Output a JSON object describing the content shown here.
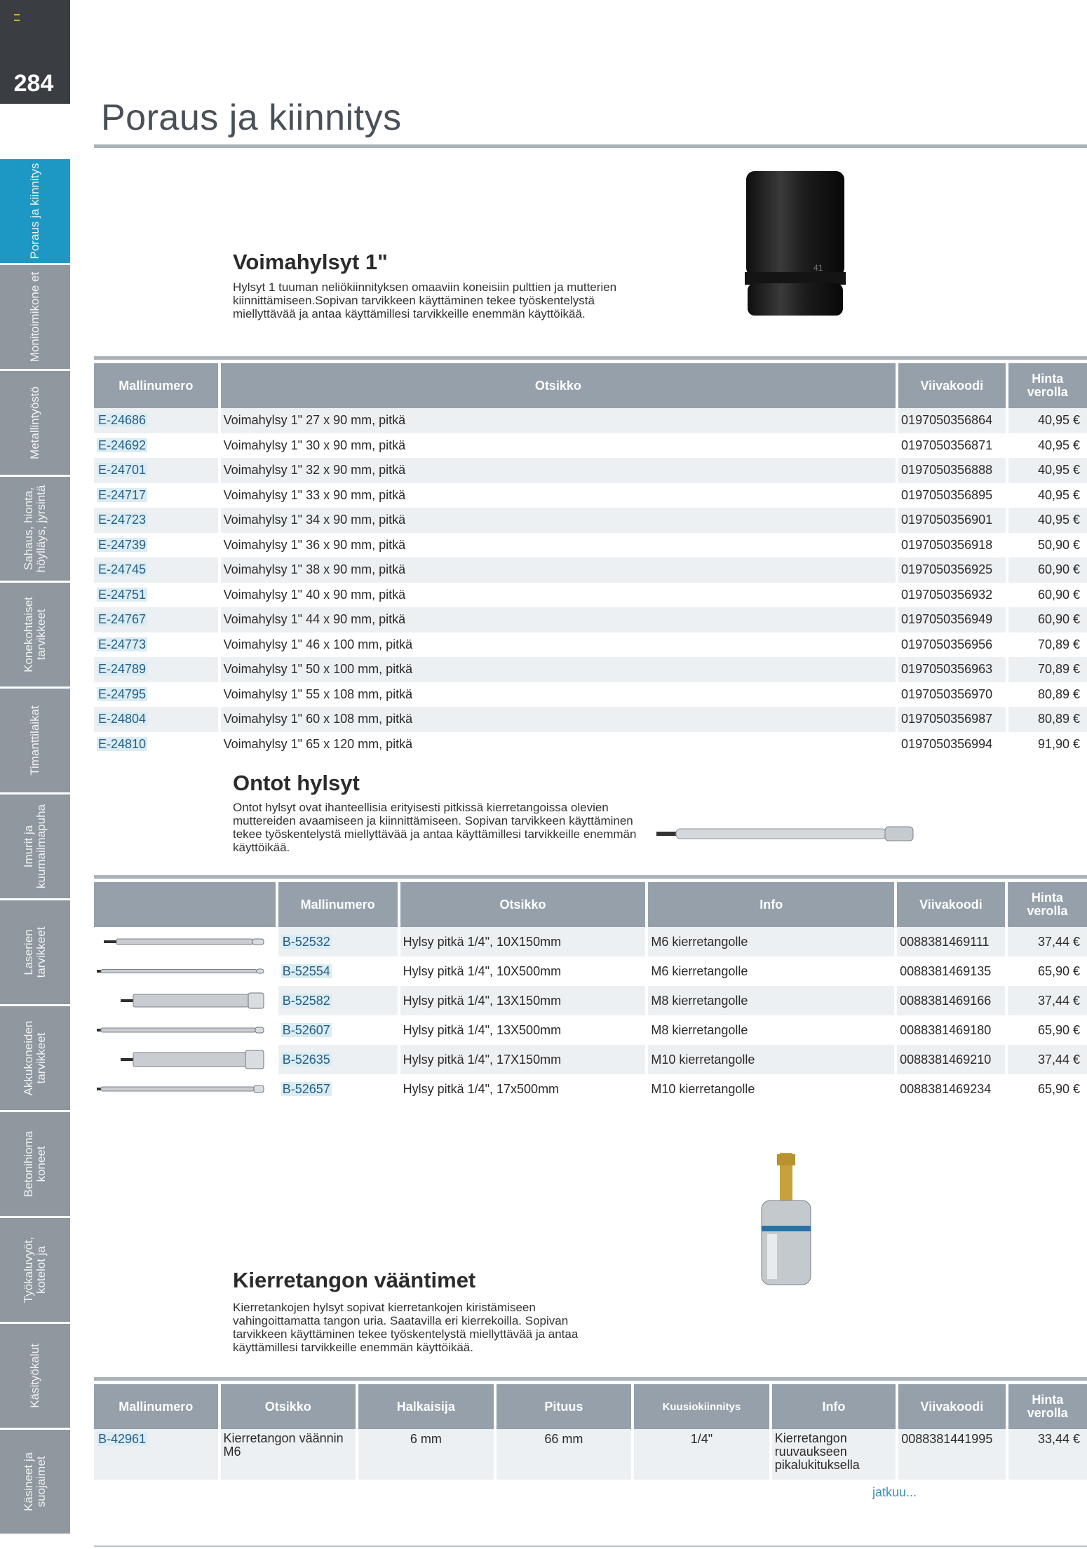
{
  "page": {
    "number": "284",
    "title": "Poraus ja kiinnitys",
    "continued": "jatkuu..."
  },
  "side_tabs": [
    {
      "label": "Poraus ja kiinnitys",
      "active": true
    },
    {
      "label": "Monitoimikone et",
      "active": false
    },
    {
      "label": "Metallintyöstö",
      "active": false
    },
    {
      "label": "Sahaus, hionta, höylläys, jyrsintä",
      "active": false
    },
    {
      "label": "Konekohtaiset tarvikkeet",
      "active": false
    },
    {
      "label": "Timanttilaikat",
      "active": false
    },
    {
      "label": "Imurit ja kuumailmapuha",
      "active": false
    },
    {
      "label": "Laserien tarvikkeet",
      "active": false
    },
    {
      "label": "Akkukoneiden tarvikkeet",
      "active": false
    },
    {
      "label": "Betonihioma koneet",
      "active": false
    },
    {
      "label": "Työkaluvyöt, kotelot ja",
      "active": false
    },
    {
      "label": "Käsityökalut",
      "active": false
    },
    {
      "label": "Käsineet ja suojaimet",
      "active": false
    }
  ],
  "voimahylsyt": {
    "title": "Voimahylsyt 1\"",
    "desc": "Hylsyt 1 tuuman neliökiinnityksen omaaviin koneisiin pulttien ja mutterien kiinnittämiseen.Sopivan tarvikkeen käyttäminen tekee työskentelystä miellyttävää ja antaa käyttämillesi tarvikkeille enemmän käyttöikää.",
    "headers": {
      "model": "Mallinumero",
      "title": "Otsikko",
      "barcode": "Viivakoodi",
      "price": "Hinta verolla"
    },
    "rows": [
      {
        "code": "E-24686",
        "title": "Voimahylsy 1\" 27 x 90 mm, pitkä",
        "barcode": "0197050356864",
        "price": "40,95 €"
      },
      {
        "code": "E-24692",
        "title": "Voimahylsy 1\" 30 x 90 mm, pitkä",
        "barcode": "0197050356871",
        "price": "40,95 €"
      },
      {
        "code": "E-24701",
        "title": "Voimahylsy 1\" 32 x 90 mm, pitkä",
        "barcode": "0197050356888",
        "price": "40,95 €"
      },
      {
        "code": "E-24717",
        "title": "Voimahylsy 1\" 33 x 90 mm, pitkä",
        "barcode": "0197050356895",
        "price": "40,95 €"
      },
      {
        "code": "E-24723",
        "title": "Voimahylsy 1\" 34 x 90 mm, pitkä",
        "barcode": "0197050356901",
        "price": "40,95 €"
      },
      {
        "code": "E-24739",
        "title": "Voimahylsy 1\" 36 x 90 mm, pitkä",
        "barcode": "0197050356918",
        "price": "50,90 €"
      },
      {
        "code": "E-24745",
        "title": "Voimahylsy 1\" 38 x 90 mm, pitkä",
        "barcode": "0197050356925",
        "price": "60,90 €"
      },
      {
        "code": "E-24751",
        "title": "Voimahylsy 1\" 40 x 90 mm, pitkä",
        "barcode": "0197050356932",
        "price": "60,90 €"
      },
      {
        "code": "E-24767",
        "title": "Voimahylsy 1\" 44 x 90 mm, pitkä",
        "barcode": "0197050356949",
        "price": "60,90 €"
      },
      {
        "code": "E-24773",
        "title": "Voimahylsy 1\" 46 x 100 mm, pitkä",
        "barcode": "0197050356956",
        "price": "70,89 €"
      },
      {
        "code": "E-24789",
        "title": "Voimahylsy 1\" 50 x 100 mm, pitkä",
        "barcode": "0197050356963",
        "price": "70,89 €"
      },
      {
        "code": "E-24795",
        "title": "Voimahylsy 1\" 55 x 108 mm, pitkä",
        "barcode": "0197050356970",
        "price": "80,89 €"
      },
      {
        "code": "E-24804",
        "title": "Voimahylsy 1\" 60 x 108 mm, pitkä",
        "barcode": "0197050356987",
        "price": "80,89 €"
      },
      {
        "code": "E-24810",
        "title": "Voimahylsy 1\" 65 x 120 mm, pitkä",
        "barcode": "0197050356994",
        "price": "91,90 €"
      }
    ]
  },
  "ontot": {
    "title": "Ontot hylsyt",
    "desc": "Ontot hylsyt ovat ihanteellisia erityisesti pitkissä kierretangoissa olevien muttereiden avaamiseen ja kiinnittämiseen. Sopivan tarvikkeen käyttäminen tekee työskentelystä miellyttävää ja antaa käyttämillesi tarvikkeille enemmän käyttöikää.",
    "headers": {
      "model": "Mallinumero",
      "title": "Otsikko",
      "info": "Info",
      "barcode": "Viivakoodi",
      "price": "Hinta verolla"
    },
    "rows": [
      {
        "code": "B-52532",
        "title": "Hylsy pitkä 1/4\", 10X150mm",
        "info": "M6 kierretangolle",
        "barcode": "0088381469111",
        "price": "37,44 €"
      },
      {
        "code": "B-52554",
        "title": "Hylsy pitkä 1/4\", 10X500mm",
        "info": "M6 kierretangolle",
        "barcode": "0088381469135",
        "price": "65,90 €"
      },
      {
        "code": "B-52582",
        "title": "Hylsy pitkä 1/4\", 13X150mm",
        "info": "M8 kierretangolle",
        "barcode": "0088381469166",
        "price": "37,44 €"
      },
      {
        "code": "B-52607",
        "title": "Hylsy pitkä 1/4\", 13X500mm",
        "info": "M8 kierretangolle",
        "barcode": "0088381469180",
        "price": "65,90 €"
      },
      {
        "code": "B-52635",
        "title": "Hylsy pitkä 1/4\", 17X150mm",
        "info": "M10 kierretangolle",
        "barcode": "0088381469210",
        "price": "37,44 €"
      },
      {
        "code": "B-52657",
        "title": "Hylsy pitkä 1/4\", 17x500mm",
        "info": "M10 kierretangolle",
        "barcode": "0088381469234",
        "price": "65,90 €"
      }
    ]
  },
  "kierretangon": {
    "title": "Kierretangon vääntimet",
    "desc": "Kierretankojen hylsyt sopivat kierretankojen kiristämiseen vahingoittamatta tangon uria. Saatavilla eri kierrekoilla. Sopivan tarvikkeen käyttäminen tekee työskentelystä miellyttävää ja antaa käyttämillesi tarvikkeille enemmän käyttöikää.",
    "headers": {
      "model": "Mallinumero",
      "title": "Otsikko",
      "diameter": "Halkaisija",
      "length": "Pituus",
      "hex": "Kuusiokiinnitys",
      "info": "Info",
      "barcode": "Viivakoodi",
      "price": "Hinta verolla"
    },
    "rows": [
      {
        "code": "B-42961",
        "title": "Kierretangon väännin M6",
        "diameter": "6 mm",
        "length": "66 mm",
        "hex": "1/4\"",
        "info": "Kierretangon ruuvaukseen pikalukituksella",
        "barcode": "0088381441995",
        "price": "33,44 €"
      }
    ]
  },
  "colors": {
    "accent": "#1d97c4",
    "header_bg": "#95a0ab",
    "side_tab": "#8f979f",
    "code_bg": "#dcecf3"
  }
}
